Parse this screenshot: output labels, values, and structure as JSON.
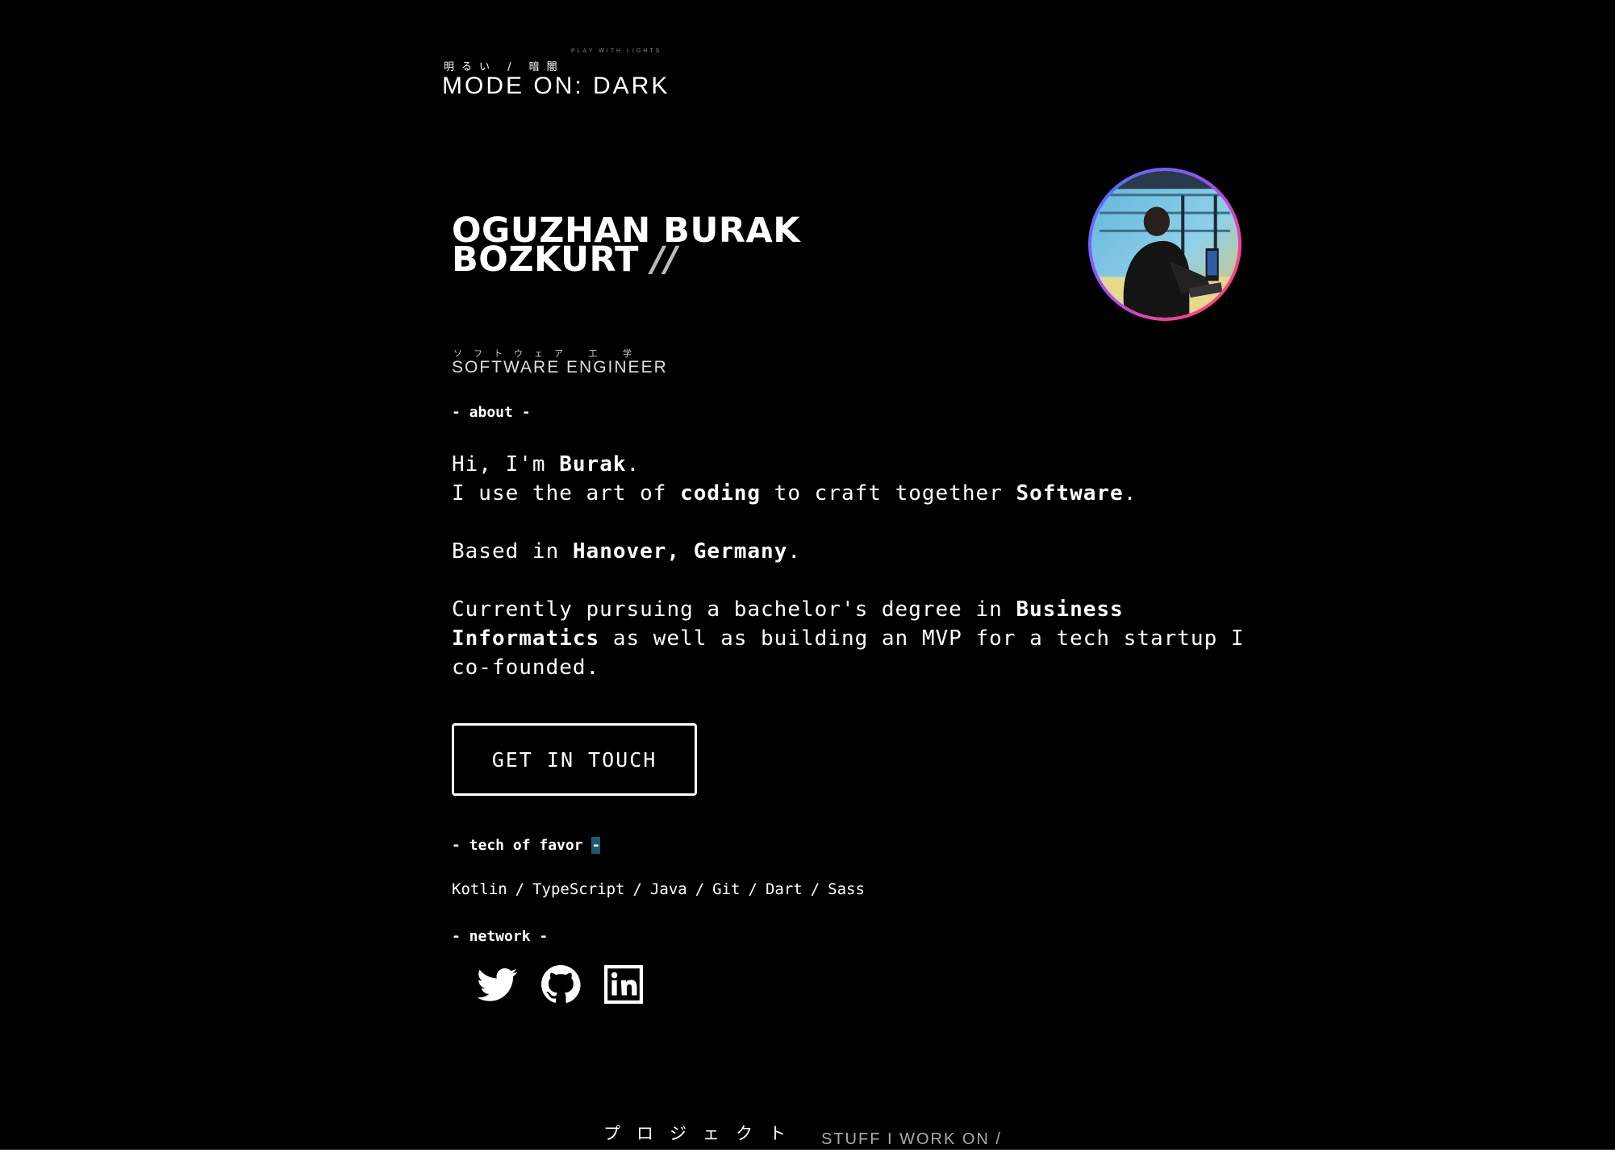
{
  "mode_toggle": {
    "jp_label": "明るい / 暗闇",
    "hint": "PLAY WITH LIGHTS",
    "label": "MODE ON: DARK"
  },
  "hero": {
    "name_line1": "OGUZHAN BURAK",
    "name_line2": "BOZKURT",
    "name_suffix": "//",
    "role_jp": "ソフトウェア 工 学",
    "role": "SOFTWARE ENGINEER"
  },
  "about": {
    "label": "- about -",
    "greeting_prefix": "Hi, I'm ",
    "greeting_name": "Burak",
    "greeting_suffix": ".",
    "craft_prefix": "I use the art of ",
    "craft_bold1": "coding",
    "craft_mid": " to craft together ",
    "craft_bold2": "Software",
    "craft_suffix": ".",
    "based_prefix": "Based in ",
    "based_location": "Hanover, Germany",
    "based_suffix": ".",
    "study_prefix": "Currently pursuing a bachelor's degree in ",
    "study_field": "Business Informatics",
    "study_suffix": " as well as building an MVP for a tech startup I co-founded."
  },
  "cta": {
    "label": "GET IN TOUCH"
  },
  "tech": {
    "label_prefix": "- tech of favor ",
    "label_suffix": "-",
    "items": [
      "Kotlin",
      "TypeScript",
      "Java",
      "Git",
      "Dart",
      "Sass"
    ],
    "separator": "/"
  },
  "network": {
    "label": "- network -",
    "icons": [
      "twitter-icon",
      "github-icon",
      "linkedin-icon"
    ]
  },
  "projects": {
    "jp_label": "プロジェクト",
    "title": "STUFF I WORK ON /"
  },
  "colors": {
    "background": "#000000",
    "text": "#ffffff",
    "avatar_ring_start": "#3a7bff",
    "avatar_ring_end": "#ff3d8b",
    "highlight": "#1e5a6e"
  }
}
